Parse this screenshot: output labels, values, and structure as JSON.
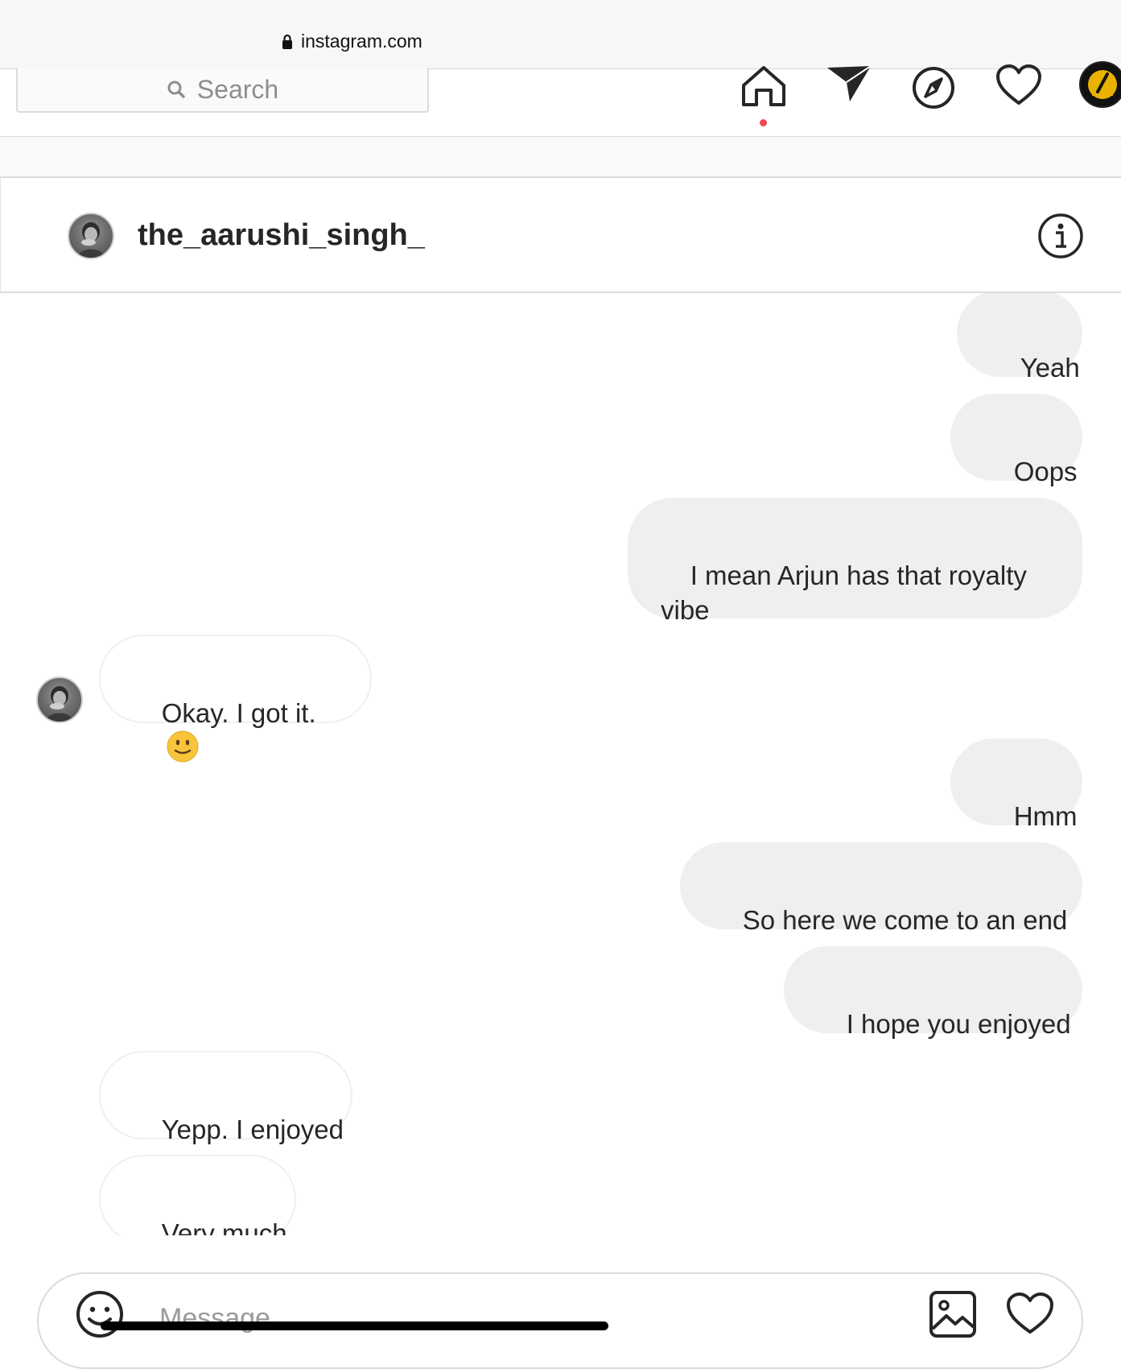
{
  "browser": {
    "url": "instagram.com",
    "lock_icon": "lock-icon"
  },
  "nav": {
    "search_placeholder": "Search",
    "icons": [
      "home-icon",
      "direct-send-icon",
      "explore-compass-icon",
      "activity-heart-icon",
      "profile-avatar"
    ],
    "notification_color": "#ed4956"
  },
  "chat": {
    "username": "the_aarushi_singh_",
    "info_icon": "info-icon"
  },
  "messages": [
    {
      "from": "me",
      "text": "Yeah"
    },
    {
      "from": "me",
      "text": "Oops"
    },
    {
      "from": "me",
      "text": "I mean Arjun has that royalty vibe"
    },
    {
      "from": "them",
      "text": "Okay. I got it.",
      "emoji": "slightly-smiling-face"
    },
    {
      "from": "me",
      "text": "Hmm"
    },
    {
      "from": "me",
      "text": "So here we come to an end"
    },
    {
      "from": "me",
      "text": "I hope you enjoyed"
    },
    {
      "from": "them",
      "text": "Yepp. I enjoyed"
    },
    {
      "from": "them",
      "text": "Very much"
    }
  ],
  "composer": {
    "placeholder": "Message...",
    "icons": [
      "emoji-icon",
      "image-upload-icon",
      "like-heart-icon"
    ]
  },
  "colors": {
    "outgoing_bubble": "#efefef",
    "incoming_border": "#efefef",
    "text": "#262626",
    "placeholder": "#8e8e8e"
  }
}
